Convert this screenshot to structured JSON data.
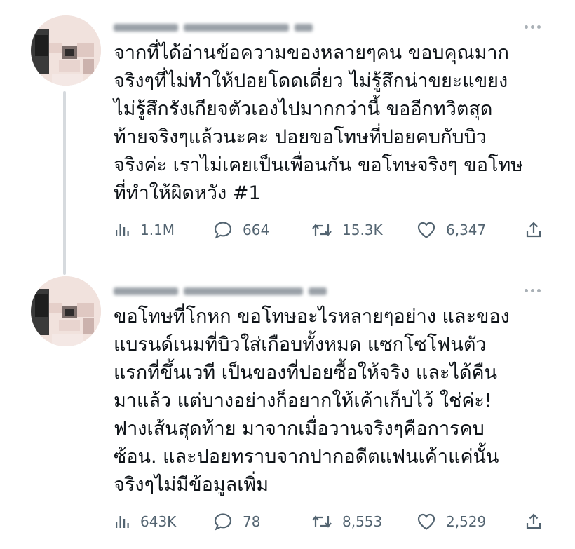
{
  "tweets": [
    {
      "text": "จากที่ได้อ่านข้อความของหลายๆคน ขอบคุณมาก\nจริงๆที่ไม่ทำให้ปอยโดดเดี่ยว ไม่รู้สึกน่าขยะแขยง\nไม่รู้สึกรังเกียจตัวเองไปมากกว่านี้ ขออีกทวิตสุด\nท้ายจริงๆแล้วนะคะ ปอยขอโทษที่ปอยคบกับบิว\nจริงค่ะ เราไม่เคยเป็นเพื่อนกัน ขอโทษจริงๆ ขอโทษ\nที่ทำให้ผิดหวัง #1",
      "views": "1.1M",
      "replies": "664",
      "retweets": "15.3K",
      "likes": "6,347"
    },
    {
      "text": "ขอโทษที่โกหก ขอโทษอะไรหลายๆอย่าง และของ\nแบรนด์เนมที่บิวใส่เกือบทั้งหมด แซกโซโฟนตัว\nแรกที่ขึ้นเวที เป็นของที่ปอยซื้อให้จริง และได้คืน\nมาแล้ว แต่บางอย่างก็อยากให้เค้าเก็บไว้ ใช่ค่ะ!\nฟางเส้นสุดท้าย มาจากเมื่อวานจริงๆคือการคบ\nซ้อน. และปอยทราบจากปากอดีตแฟนเค้าแค่นั้น\nจริงๆไม่มีข้อมูลเพิ่ม",
      "views": "643K",
      "replies": "78",
      "retweets": "8,553",
      "likes": "2,529"
    }
  ],
  "icons": {
    "views": "bar-chart-icon",
    "reply": "comment-bubble-icon",
    "retweet": "retweet-arrows-icon",
    "like": "heart-icon",
    "share": "share-upload-icon",
    "more": "more-dots-icon"
  },
  "colors": {
    "text": "#0f1419",
    "secondary": "#536471",
    "thread_line": "#d6dade",
    "background": "#ffffff"
  }
}
